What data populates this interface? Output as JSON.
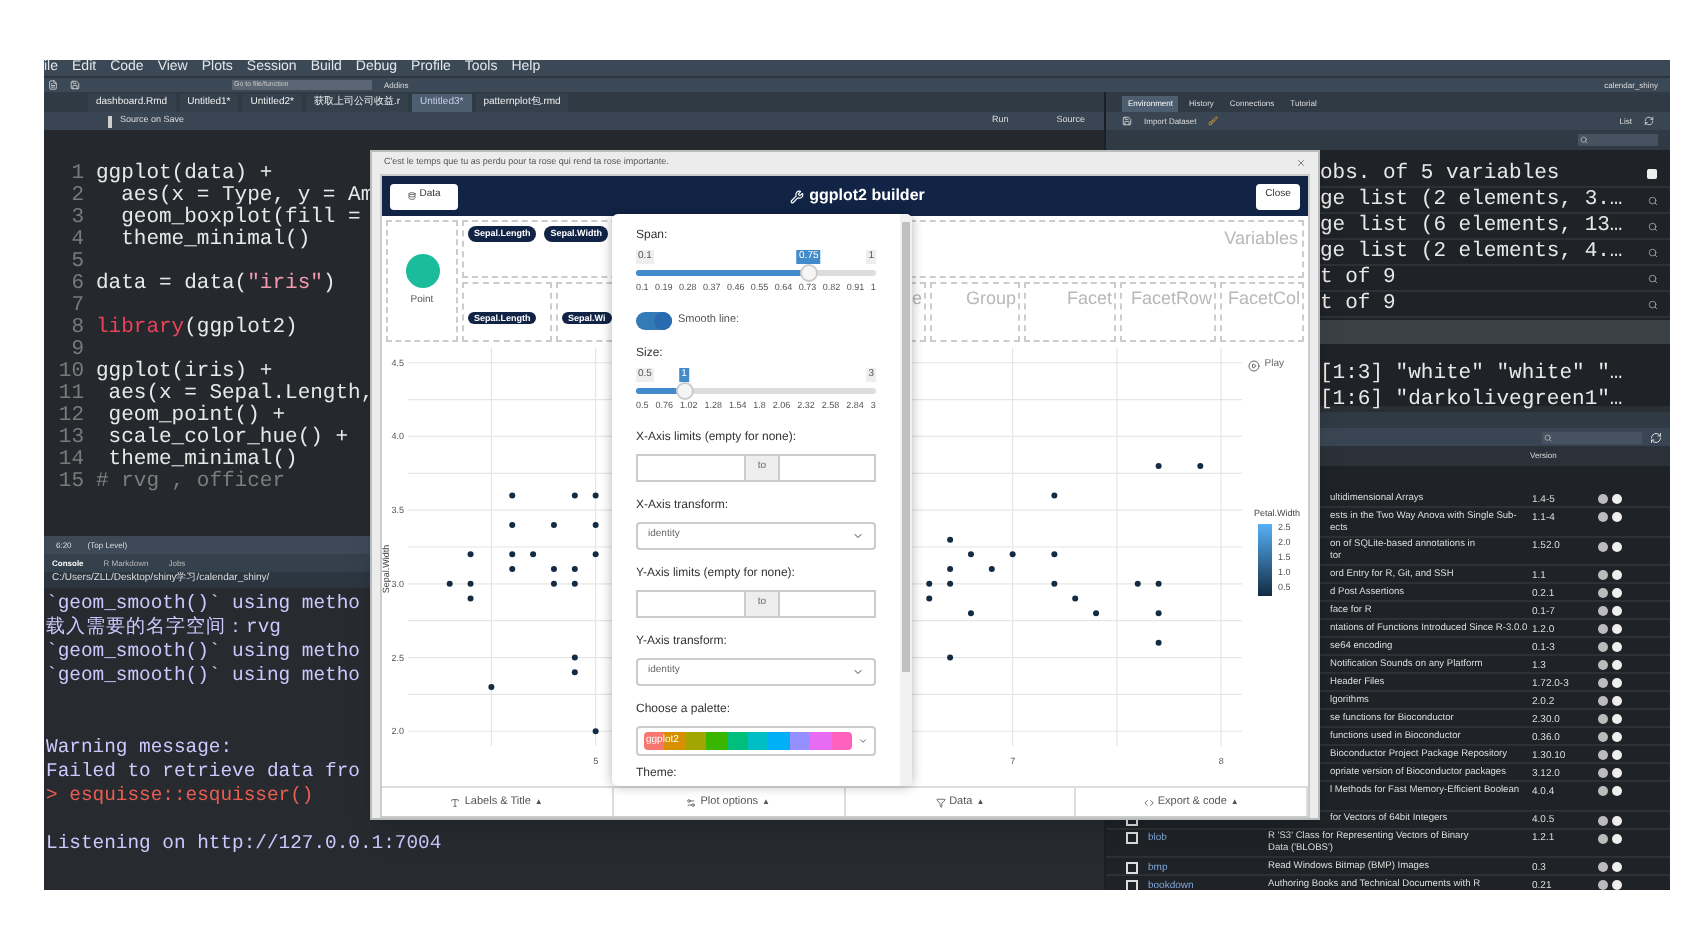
{
  "menu": [
    "ile",
    "Edit",
    "Code",
    "View",
    "Plots",
    "Session",
    "Build",
    "Debug",
    "Profile",
    "Tools",
    "Help"
  ],
  "toolbar": {
    "goto_placeholder": "Go to file/function",
    "addins": "Addins",
    "project": "calendar_shiny"
  },
  "editor": {
    "tabs": [
      {
        "label": "dashboard.Rmd",
        "selected": false
      },
      {
        "label": "Untitled1*",
        "selected": false
      },
      {
        "label": "Untitled2*",
        "selected": false
      },
      {
        "label": "获取上司公司收益.r",
        "selected": false
      },
      {
        "label": "Untitled3*",
        "selected": true
      },
      {
        "label": "patternplot包.rmd",
        "selected": false
      }
    ],
    "source_on_save": "Source on Save",
    "source_on_save_checked": false,
    "run": "Run",
    "source": "Source",
    "lines": [
      {
        "num": "1",
        "parts": [
          {
            "kind": "plain",
            "text": "ggplot(data) +"
          }
        ]
      },
      {
        "num": "2",
        "parts": [
          {
            "kind": "plain",
            "text": "  aes(x = Type, y = Am"
          }
        ]
      },
      {
        "num": "3",
        "parts": [
          {
            "kind": "plain",
            "text": "  geom_boxplot(fill = "
          }
        ]
      },
      {
        "num": "4",
        "parts": [
          {
            "kind": "plain",
            "text": "  theme_minimal()"
          }
        ]
      },
      {
        "num": "5"
      },
      {
        "num": "6",
        "parts": [
          {
            "kind": "plain",
            "text": "data = data("
          },
          {
            "kind": "string",
            "text": "\"iris\""
          },
          {
            "kind": "plain",
            "text": ")"
          }
        ]
      },
      {
        "num": "7"
      },
      {
        "num": "8",
        "parts": [
          {
            "kind": "keyword",
            "text": "library"
          },
          {
            "kind": "plain",
            "text": "(ggplot2)"
          }
        ]
      },
      {
        "num": "9"
      },
      {
        "num": "10",
        "parts": [
          {
            "kind": "plain",
            "text": "ggplot(iris) +"
          }
        ]
      },
      {
        "num": "11",
        "parts": [
          {
            "kind": "plain",
            "text": " aes(x = Sepal.Length,"
          }
        ]
      },
      {
        "num": "12",
        "parts": [
          {
            "kind": "plain",
            "text": " geom_point() +"
          }
        ]
      },
      {
        "num": "13",
        "parts": [
          {
            "kind": "plain",
            "text": " scale_color_hue() +"
          }
        ]
      },
      {
        "num": "14",
        "parts": [
          {
            "kind": "plain",
            "text": " theme_minimal()"
          }
        ]
      },
      {
        "num": "15",
        "parts": [
          {
            "kind": "comment",
            "text": "# rvg , officer"
          }
        ]
      }
    ],
    "position": "6:20",
    "scope": "(Top Level)"
  },
  "console": {
    "tabs": [
      {
        "label": "Console",
        "selected": true
      },
      {
        "label": "R Markdown",
        "selected": false
      },
      {
        "label": "Jobs",
        "selected": false
      }
    ],
    "path": "C:/Users/ZLL/Desktop/shiny学习/calendar_shiny/",
    "lines": [
      {
        "kind": "output",
        "text": "`geom_smooth()` using metho"
      },
      {
        "kind": "output",
        "text": "载入需要的名字空间：rvg"
      },
      {
        "kind": "output",
        "text": "`geom_smooth()` using metho"
      },
      {
        "kind": "output",
        "text": "`geom_smooth()` using metho"
      },
      {
        "kind": "blank"
      },
      {
        "kind": "blank"
      },
      {
        "kind": "output",
        "text": "Warning message:"
      },
      {
        "kind": "output",
        "text": "Failed to retrieve data fro"
      },
      {
        "kind": "command",
        "text": "> esquisse::esquisser()"
      },
      {
        "kind": "blank"
      },
      {
        "kind": "output",
        "text": "Listening on http://127.0.0.1:7004"
      }
    ]
  },
  "environment": {
    "tabs": [
      {
        "label": "Environment",
        "selected": true
      },
      {
        "label": "History",
        "selected": false
      },
      {
        "label": "Connections",
        "selected": false
      },
      {
        "label": "Tutorial",
        "selected": false
      }
    ],
    "import_dataset": "Import Dataset",
    "view_mode": "List",
    "data_rows": [
      "obs. of 5 variables",
      "ge list (2 elements, 3.…",
      "ge list (6 elements, 13…",
      "ge list (2 elements, 4.…",
      "t of 9",
      "t of 9"
    ],
    "value_rows": [
      "[1:3] \"white\" \"white\" \"…",
      "[1:6] \"darkolivegreen1\"…"
    ]
  },
  "packages": {
    "version_header": "Version",
    "rows": [
      {
        "kind": "clipped",
        "desc": [
          "ultidimensional Arrays"
        ],
        "version": "1.4-5"
      },
      {
        "kind": "clipped",
        "desc": [
          "ests in the Two Way Anova with Single Sub-",
          "ects"
        ],
        "version": "1.1-4"
      },
      {
        "kind": "clipped",
        "desc": [
          "on of SQLite-based annotations in",
          "tor"
        ],
        "version": "1.52.0"
      },
      {
        "kind": "clipped",
        "desc": [
          "ord Entry for R, Git, and SSH"
        ],
        "version": "1.1"
      },
      {
        "kind": "clipped",
        "desc": [
          "d Post Assertions"
        ],
        "version": "0.2.1"
      },
      {
        "kind": "clipped",
        "desc": [
          "face for R"
        ],
        "version": "0.1-7"
      },
      {
        "kind": "clipped",
        "desc": [
          "ntations of Functions Introduced Since R-3.0.0"
        ],
        "version": "1.2.0"
      },
      {
        "kind": "clipped",
        "desc": [
          "se64 encoding"
        ],
        "version": "0.1-3"
      },
      {
        "kind": "clipped",
        "desc": [
          "Notification Sounds on any Platform"
        ],
        "version": "1.3"
      },
      {
        "kind": "clipped",
        "desc": [
          "Header Files"
        ],
        "version": "1.72.0-3"
      },
      {
        "kind": "clipped",
        "desc": [
          "lgorithms"
        ],
        "version": "2.0.2"
      },
      {
        "kind": "clipped",
        "desc": [
          "se functions for Bioconductor"
        ],
        "version": "2.30.0"
      },
      {
        "kind": "clipped",
        "desc": [
          "functions used in Bioconductor"
        ],
        "version": "0.36.0"
      },
      {
        "kind": "clipped",
        "desc": [
          "Bioconductor Project Package Repository"
        ],
        "version": "1.30.10"
      },
      {
        "kind": "clipped",
        "desc": [
          "opriate version of Bioconductor packages"
        ],
        "version": "3.12.0"
      },
      {
        "kind": "clipped_tall",
        "desc": [
          "l Methods for Fast Memory-Efficient Boolean"
        ],
        "version": "4.0.4"
      },
      {
        "kind": "clipped",
        "checked": false,
        "desc": [
          "for Vectors of 64bit Integers"
        ],
        "version": "4.0.5"
      },
      {
        "kind": "full",
        "checked": false,
        "name": "blob",
        "desc": [
          "R 'S3' Class for Representing Vectors of Binary",
          "Data ('BLOBS')"
        ],
        "version": "1.2.1"
      },
      {
        "kind": "full",
        "checked": false,
        "name": "bmp",
        "desc": [
          "Read Windows Bitmap (BMP) Images"
        ],
        "version": "0.3"
      },
      {
        "kind": "full",
        "checked": false,
        "name": "bookdown",
        "desc": [
          "Authoring Books and Technical Documents with R"
        ],
        "version": "0.21"
      }
    ]
  },
  "dialog": {
    "message": "C'est le temps que tu as perdu pour ta rose qui rend ta rose importante.",
    "data_button": "Data",
    "title": "ggplot2 builder",
    "close_button": "Close",
    "geom": "Point",
    "variables_label": "Variables",
    "variables": [
      "Sepal.Length",
      "Sepal.Width"
    ],
    "zones": [
      {
        "chip": "Sepal.Length"
      },
      {
        "chip": "Sepal.Wi"
      },
      {
        "label": "e"
      },
      {
        "label": "Group"
      },
      {
        "label": "Facet"
      },
      {
        "label": "FacetRow"
      },
      {
        "label": "FacetCol"
      }
    ],
    "play": "Play",
    "chart_data": {
      "type": "scatter",
      "ylabel": "Sepal.Width",
      "xlim": [
        4.1,
        8.1
      ],
      "ylim": [
        1.9,
        4.6
      ],
      "grid": true,
      "xticks": [
        5,
        7,
        8
      ],
      "yticks": [
        {
          "value": 2,
          "label": "2.0"
        },
        {
          "value": 2.5,
          "label": "2.5"
        },
        {
          "value": 3,
          "label": "3.0"
        },
        {
          "value": 3.5,
          "label": "3.5"
        },
        {
          "value": 4,
          "label": "4.0"
        },
        {
          "value": 4.5,
          "label": "4.5"
        }
      ],
      "x": [
        4.6,
        4.9,
        5.0,
        4.6,
        4.8,
        5.0,
        4.4,
        4.6,
        4.7,
        5.0,
        4.6,
        4.8,
        4.9,
        4.3,
        4.4,
        4.8,
        4.9,
        4.4,
        4.9,
        4.9,
        4.5,
        5.0,
        7.7,
        7.9,
        7.2,
        6.7,
        6.8,
        7.0,
        7.2,
        6.7,
        6.9,
        6.6,
        6.7,
        7.2,
        7.6,
        7.7,
        6.6,
        7.3,
        6.8,
        7.4,
        7.7,
        7.7,
        6.7
      ],
      "series": [
        {
          "color": "#132b43",
          "values": [
            3.6,
            3.6,
            3.6,
            3.4,
            3.4,
            3.4,
            3.2,
            3.2,
            3.2,
            3.2,
            3.1,
            3.1,
            3.1,
            3.0,
            3.0,
            3.0,
            3.0,
            2.9,
            2.5,
            2.4,
            2.3,
            2.0,
            3.8,
            3.8,
            3.6,
            3.3,
            3.2,
            3.2,
            3.2,
            3.1,
            3.1,
            3.0,
            3.0,
            3.0,
            3.0,
            3.0,
            2.9,
            2.9,
            2.8,
            2.8,
            2.8,
            2.6,
            2.5
          ]
        }
      ]
    },
    "legend": {
      "title": "Petal.Width",
      "labels": [
        "2.5",
        "2.0",
        "1.5",
        "1.0",
        "0.5"
      ]
    },
    "bottom_tabs": [
      {
        "kind": "labels",
        "label": "Labels & Title",
        "caret": "▲"
      },
      {
        "kind": "options",
        "label": "Plot options",
        "caret": "▲"
      },
      {
        "kind": "data",
        "label": "Data",
        "caret": "▲"
      },
      {
        "kind": "export",
        "label": "Export & code",
        "caret": "▲"
      }
    ],
    "options": {
      "span": {
        "label": "Span:",
        "min": "0.1",
        "max": "1",
        "value": "0.75",
        "level": 0.72,
        "ticks": [
          "0.1",
          "0.19",
          "0.28",
          "0.37",
          "0.46",
          "0.55",
          "0.64",
          "0.73",
          "0.82",
          "0.91",
          "1"
        ]
      },
      "smooth_line": {
        "label": "Smooth line:",
        "on": true
      },
      "size": {
        "label": "Size:",
        "min": "0.5",
        "max": "3",
        "value": "1",
        "level": 0.2,
        "ticks": [
          "0.5",
          "0.76",
          "1.02",
          "1.28",
          "1.54",
          "1.8",
          "2.06",
          "2.32",
          "2.58",
          "2.84",
          "3"
        ]
      },
      "x_limits": {
        "label": "X-Axis limits (empty for none):",
        "to": "to"
      },
      "x_transform": {
        "label": "X-Axis transform:",
        "value": "identity"
      },
      "y_limits": {
        "label": "Y-Axis limits (empty for none):",
        "to": "to"
      },
      "y_transform": {
        "label": "Y-Axis transform:",
        "value": "identity"
      },
      "palette": {
        "label": "Choose a palette:",
        "value": "ggplot2"
      },
      "theme": {
        "label": "Theme:"
      }
    }
  }
}
